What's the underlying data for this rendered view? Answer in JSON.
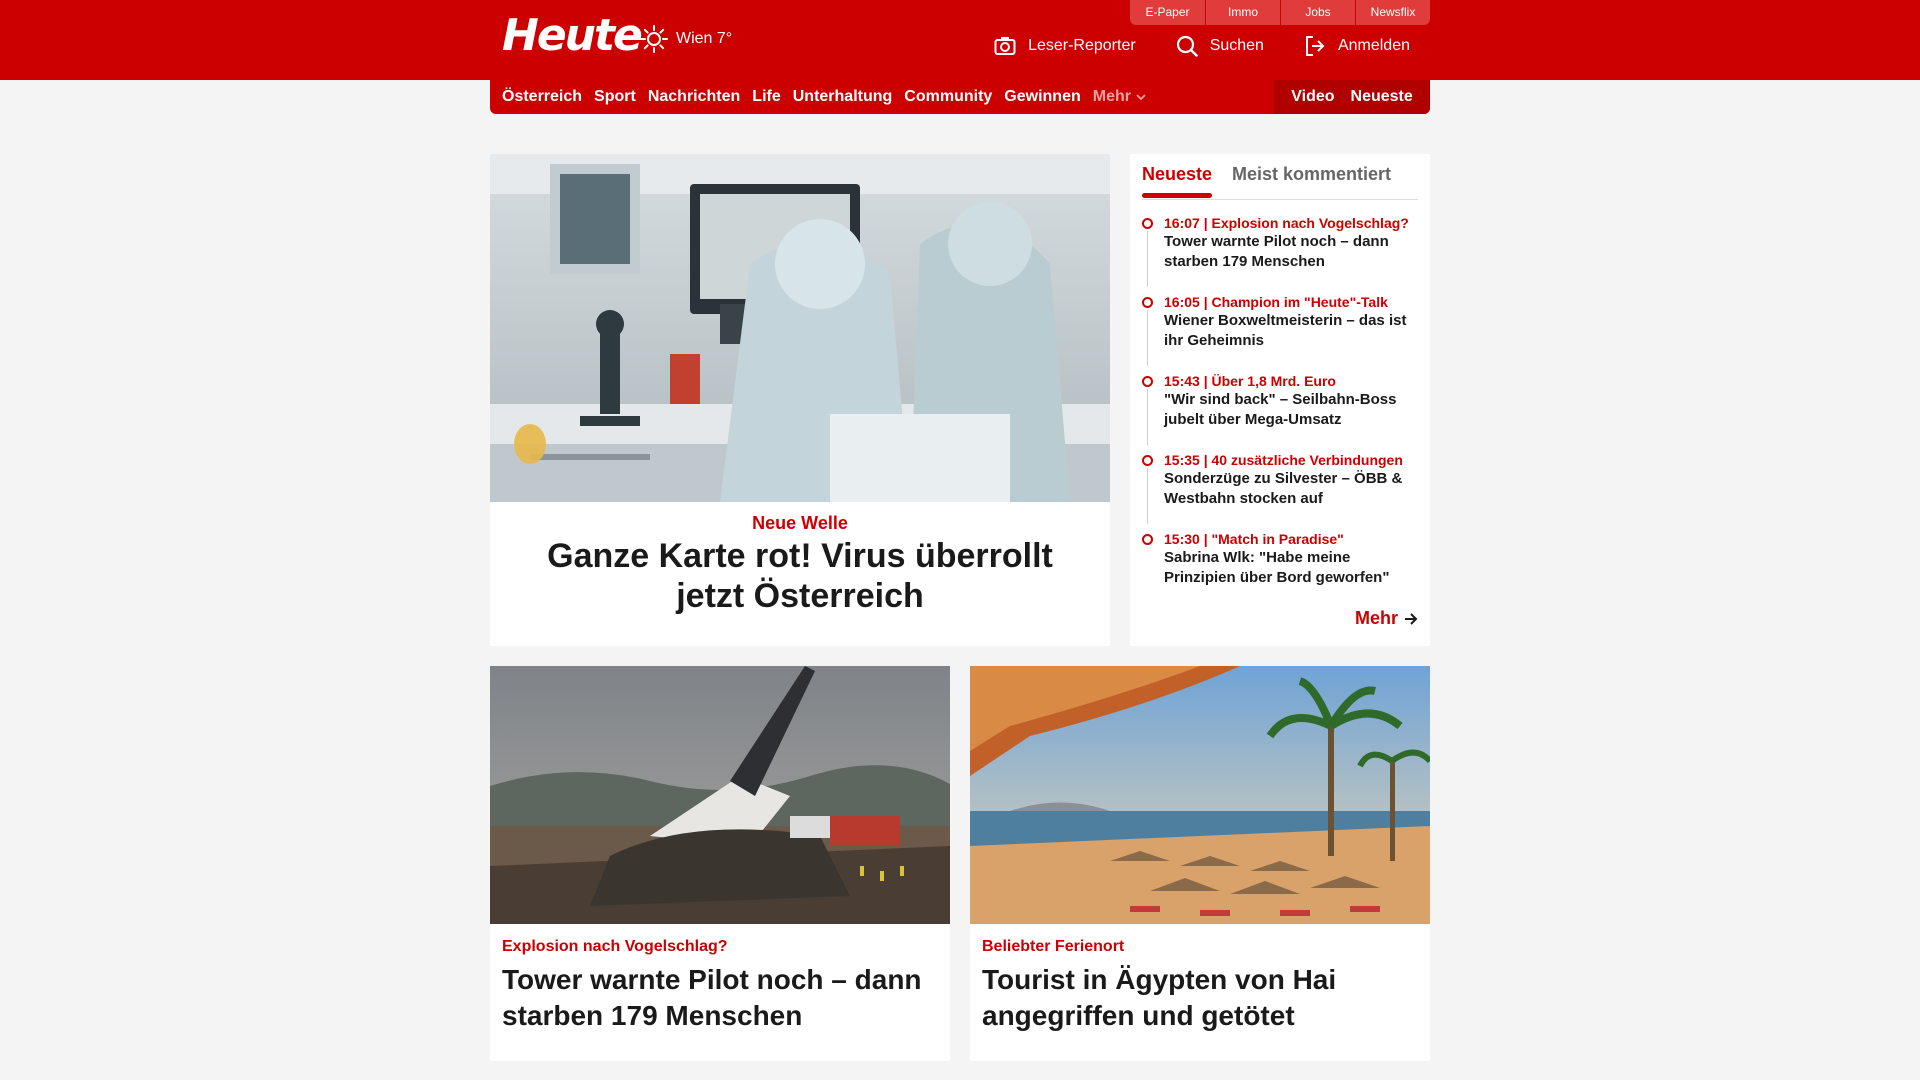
{
  "header": {
    "logo": "Heute",
    "weather": "Wien 7°",
    "util_links": [
      "E-Paper",
      "Immo",
      "Jobs",
      "Newsflix"
    ],
    "actions": {
      "reporter": "Leser-Reporter",
      "search": "Suchen",
      "login": "Anmelden"
    }
  },
  "nav": {
    "items": [
      "Österreich",
      "Sport",
      "Nachrichten",
      "Life",
      "Unterhaltung",
      "Community",
      "Gewinnen"
    ],
    "more": "Mehr",
    "video": "Video",
    "newest": "Neueste"
  },
  "hero": {
    "kicker": "Neue Welle",
    "title": "Ganze Karte rot! Virus überrollt jetzt Österreich"
  },
  "sidebar": {
    "tab_active": "Neueste",
    "tab_other": "Meist kommentiert",
    "items": [
      {
        "meta": "16:07 | Explosion nach Vogelschlag?",
        "title": "Tower warnte Pilot noch – dann starben 179 Menschen"
      },
      {
        "meta": "16:05 | Champion im \"Heute\"-Talk",
        "title": "Wiener Boxweltmeisterin – das ist ihr Geheimnis"
      },
      {
        "meta": "15:43 | Über 1,8 Mrd. Euro",
        "title": "\"Wir sind back\" – Seilbahn-Boss jubelt über Mega-Umsatz"
      },
      {
        "meta": "15:35 | 40 zusätzliche Verbindungen",
        "title": "Sonderzüge zu Silvester – ÖBB & Westbahn stocken auf"
      },
      {
        "meta": "15:30 | \"Match in Paradise\"",
        "title": "Sabrina Wlk: \"Habe meine Prinzipien über Bord geworfen\""
      }
    ],
    "more": "Mehr"
  },
  "cards": [
    {
      "kicker": "Explosion nach Vogelschlag?",
      "title": "Tower warnte Pilot noch – dann starben 179 Menschen"
    },
    {
      "kicker": "Beliebter Ferienort",
      "title": "Tourist in Ägypten von Hai angegriffen und getötet"
    }
  ],
  "colors": {
    "brand": "#cc0000",
    "background": "#f4f4f4",
    "text": "#1a1a1a"
  }
}
